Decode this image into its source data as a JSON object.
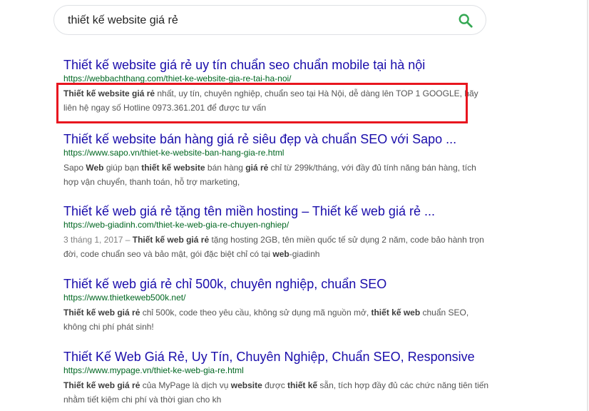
{
  "search": {
    "query": "thiết kế website giá rẻ"
  },
  "colors": {
    "title": "#1a0dab",
    "url": "#006621",
    "snippet": "#545454",
    "highlight": "#e8161f",
    "search_icon": "#34a853"
  },
  "results": [
    {
      "title": "Thiết kế website giá rẻ uy tín chuẩn seo chuẩn mobile tại hà nội",
      "url": "https://webbachthang.com/thiet-ke-website-gia-re-tai-ha-noi/",
      "snippet": [
        {
          "t": "Thiết kế website giá rẻ",
          "b": true
        },
        {
          "t": " nhất, uy tín, chuyên nghiệp, chuẩn seo tại Hà Nội, dễ dàng lên TOP 1 GOOGLE, hãy liên hệ ngay số Hotline 0973.361.201 để được tư vấn",
          "b": false
        }
      ]
    },
    {
      "title": "Thiết kế website bán hàng giá rẻ siêu đẹp và chuẩn SEO với Sapo ...",
      "url": "https://www.sapo.vn/thiet-ke-website-ban-hang-gia-re.html",
      "snippet": [
        {
          "t": "Sapo ",
          "b": false
        },
        {
          "t": "Web",
          "b": true
        },
        {
          "t": " giúp bạn ",
          "b": false
        },
        {
          "t": "thiết kế website",
          "b": true
        },
        {
          "t": " bán hàng ",
          "b": false
        },
        {
          "t": "giá rẻ",
          "b": true
        },
        {
          "t": " chỉ từ 299k/tháng, với đầy đủ tính năng bán hàng, tích hợp vận chuyển, thanh toán, hỗ trợ marketing,",
          "b": false
        }
      ]
    },
    {
      "title": "Thiết kế web giá rẻ tặng tên miền hosting – Thiết kế web giá rẻ ...",
      "url": "https://web-giadinh.com/thiet-ke-web-gia-re-chuyen-nghiep/",
      "date": "3 tháng 1, 2017 – ",
      "snippet": [
        {
          "t": "Thiết kế web giá rẻ",
          "b": true
        },
        {
          "t": " tặng hosting 2GB, tên miền quốc tế sử dụng 2 năm, code bảo hành trọn đời, code chuẩn seo và bảo mật, gói đặc biệt chỉ có tại ",
          "b": false
        },
        {
          "t": "web",
          "b": true
        },
        {
          "t": "-giadinh",
          "b": false
        }
      ]
    },
    {
      "title": "Thiết kế web giá rẻ chỉ 500k, chuyên nghiệp, chuẩn SEO",
      "url": "https://www.thietkeweb500k.net/",
      "snippet": [
        {
          "t": "Thiết kế web giá rẻ",
          "b": true
        },
        {
          "t": " chỉ 500k, code theo yêu cầu, không sử dụng mã nguồn mở, ",
          "b": false
        },
        {
          "t": "thiết kế web",
          "b": true
        },
        {
          "t": " chuẩn SEO, không chi phí phát sinh!",
          "b": false
        }
      ]
    },
    {
      "title": "Thiết Kế Web Giá Rẻ, Uy Tín, Chuyên Nghiệp, Chuẩn SEO, Responsive",
      "url": "https://www.mypage.vn/thiet-ke-web-gia-re.html",
      "snippet": [
        {
          "t": "Thiết kế web giá rẻ",
          "b": true
        },
        {
          "t": " của MyPage là dịch vụ ",
          "b": false
        },
        {
          "t": "website",
          "b": true
        },
        {
          "t": " được ",
          "b": false
        },
        {
          "t": "thiết kế",
          "b": true
        },
        {
          "t": " sẵn, tích hợp đầy đủ các chức năng tiên tiến nhằm tiết kiệm chi phí và thời gian cho kh",
          "b": false
        }
      ]
    }
  ]
}
